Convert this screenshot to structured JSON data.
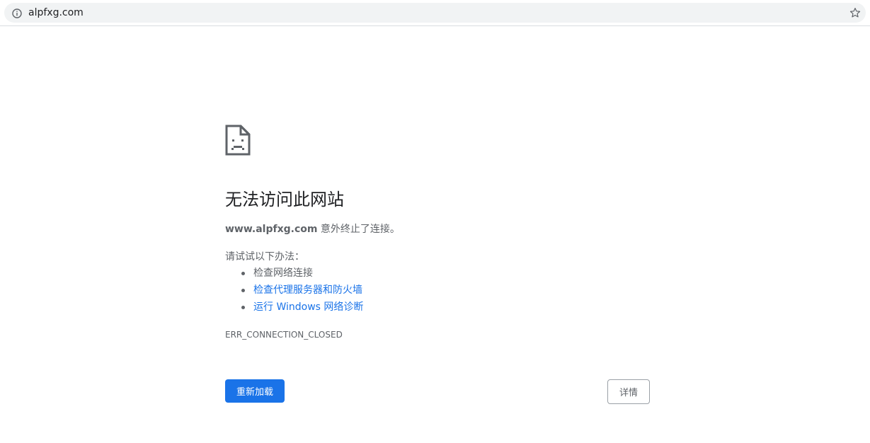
{
  "browser": {
    "address_bar": {
      "url": "alpfxg.com",
      "site_info_icon": "info-icon",
      "bookmark_icon": "star-outline-icon"
    }
  },
  "error_page": {
    "icon": "sad-document-icon",
    "title": "无法访问此网站",
    "summary_host": "www.alpfxg.com",
    "summary_text": " 意外终止了连接。",
    "suggestions_heading": "请试试以下办法：",
    "suggestions": [
      {
        "label": "检查网络连接",
        "is_link": false
      },
      {
        "label": "检查代理服务器和防火墙",
        "is_link": true
      },
      {
        "label": "运行 Windows 网络诊断",
        "is_link": true
      }
    ],
    "error_code": "ERR_CONNECTION_CLOSED",
    "reload_label": "重新加载",
    "details_label": "详情"
  },
  "colors": {
    "accent": "#1a73e8",
    "text_secondary": "#5f6368",
    "omnibox_bg": "#f1f3f4"
  }
}
